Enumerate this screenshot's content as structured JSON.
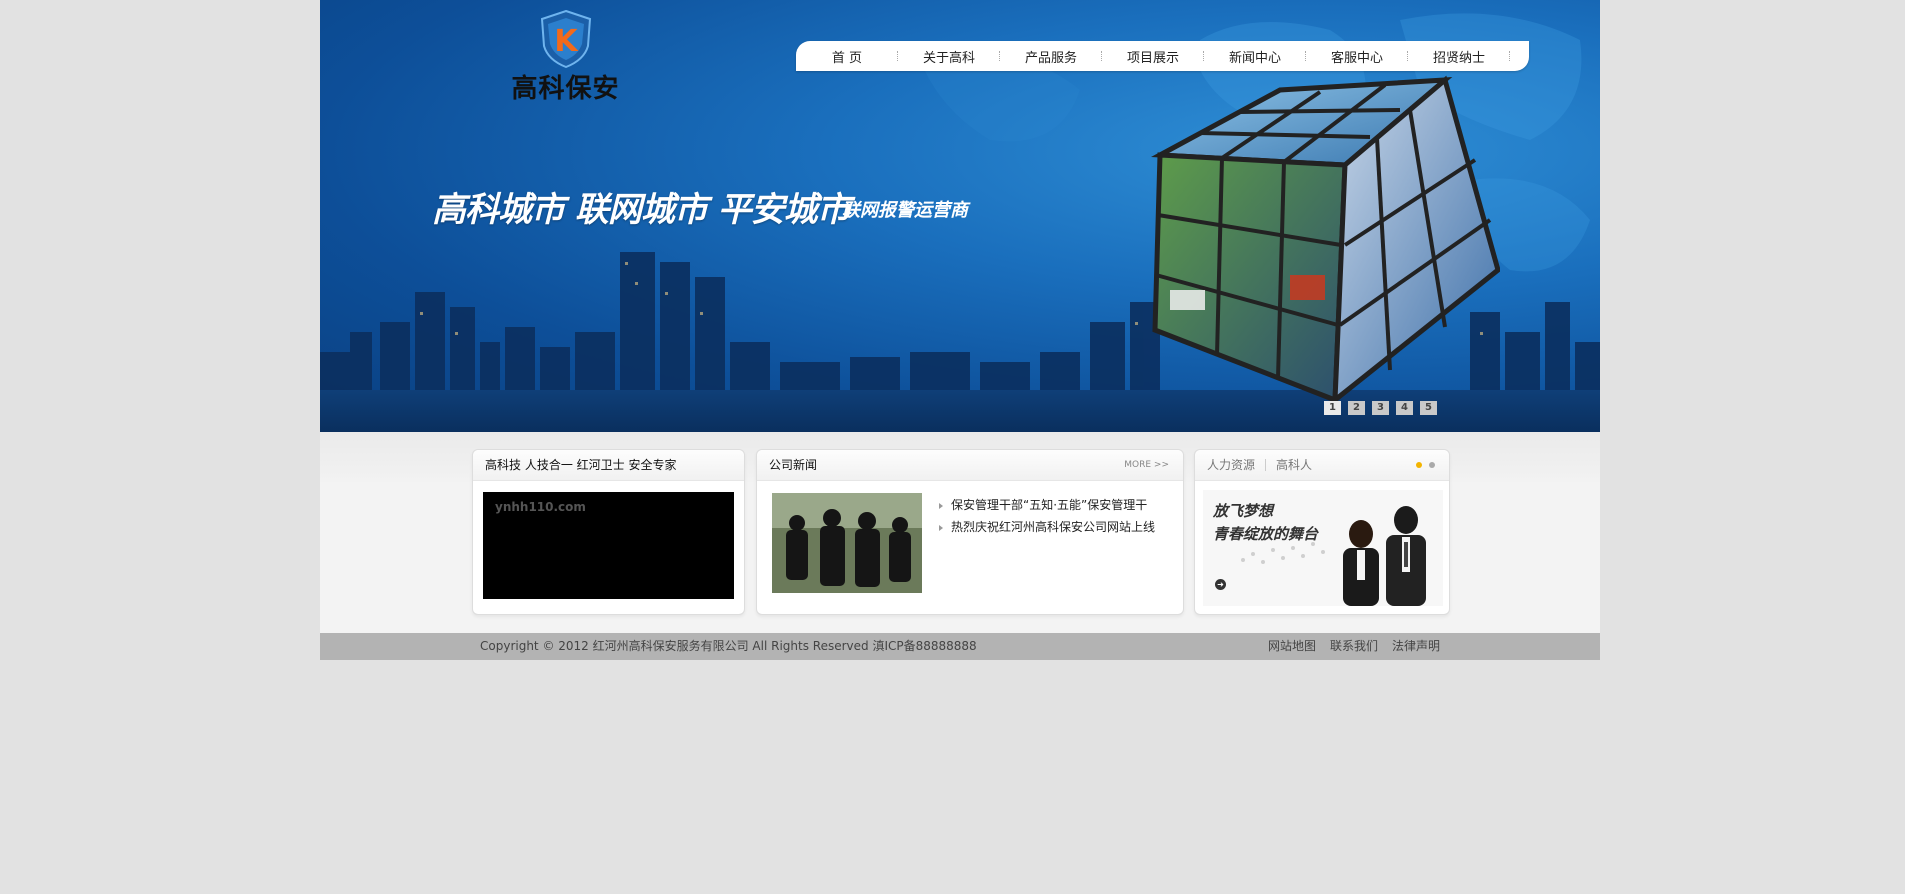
{
  "brand": {
    "name": "高科保安",
    "logo_letter": "K"
  },
  "nav": [
    "首 页",
    "关于高科",
    "产品服务",
    "项目展示",
    "新闻中心",
    "客服中心",
    "招贤纳士"
  ],
  "banner": {
    "slogan": "高科城市 联网城市 平安城市",
    "slogan_sub": "联网报警运营商",
    "pager": [
      "1",
      "2",
      "3",
      "4",
      "5"
    ],
    "active_slide": 1
  },
  "panel_video": {
    "title": "高科技 人技合一 红河卫士 安全专家",
    "watermark": "ynhh110.com"
  },
  "panel_news": {
    "title": "公司新闻",
    "more": "MORE >>",
    "items": [
      "保安管理干部“五知·五能”保安管理干",
      "热烈庆祝红河州高科保安公司网站上线"
    ]
  },
  "panel_hr": {
    "tabs": [
      "人力资源",
      "高科人"
    ],
    "ad_line1": "放飞梦想",
    "ad_line2": "青春绽放的舞台"
  },
  "footer": {
    "copyright": "Copyright © 2012 红河州高科保安服务有限公司 All Rights Reserved 滇ICP备88888888",
    "links": [
      "网站地图",
      "联系我们",
      "法律声明"
    ]
  },
  "colors": {
    "banner_blue": "#1a6fbd",
    "accent_yellow": "#f3b400",
    "footer_gray": "#b3b3b3"
  }
}
